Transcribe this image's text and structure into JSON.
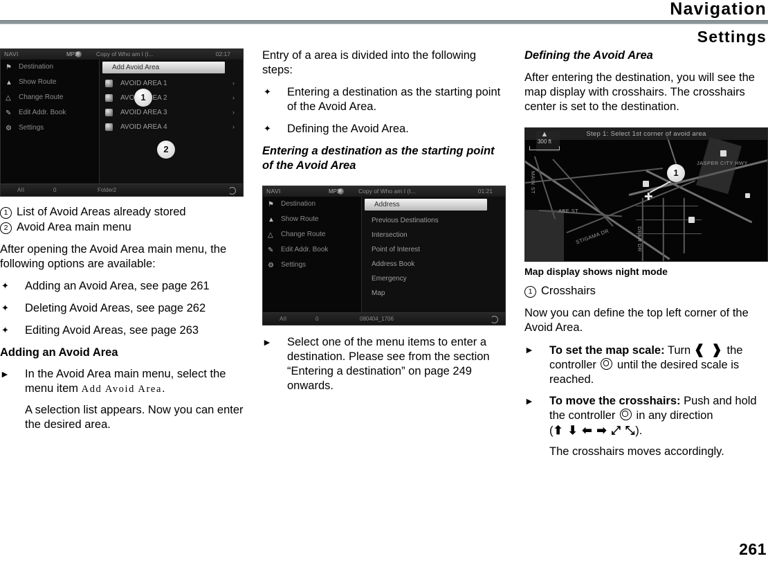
{
  "header": {
    "title": "Navigation",
    "subtitle": "Settings"
  },
  "page_number": "261",
  "column_1": {
    "screenshot": {
      "topbar": {
        "source": "NAVI",
        "disc_label": "MP3",
        "track": "Copy of Who am I (I...",
        "clock": "02:17"
      },
      "left_menu": [
        {
          "icon": "flag-icon",
          "label": "Destination"
        },
        {
          "icon": "route-icon",
          "label": "Show Route"
        },
        {
          "icon": "change-route-icon",
          "label": "Change Route"
        },
        {
          "icon": "pencil-icon",
          "label": "Edit Addr. Book"
        },
        {
          "icon": "gear-icon",
          "label": "Settings"
        }
      ],
      "highlighted_item": "Add Avoid Area",
      "avoid_areas": [
        "AVOID AREA 1",
        "AVOID AREA 2",
        "AVOID AREA 3",
        "AVOID AREA 4"
      ],
      "bottombar": {
        "left": "All",
        "mid": "0",
        "label": "Folder2"
      },
      "callouts": [
        "1",
        "2"
      ]
    },
    "legend": [
      {
        "num": "1",
        "text": "List of Avoid Areas already stored"
      },
      {
        "num": "2",
        "text": "Avoid Area main menu"
      }
    ],
    "intro": "After opening the Avoid Area main menu, the following options are available:",
    "bullets": [
      "Adding an Avoid Area, see page 261",
      "Deleting Avoid Areas, see page 262",
      "Editing Avoid Areas, see page 263"
    ],
    "heading": "Adding an Avoid Area",
    "action": {
      "text_before": "In the Avoid Area main menu, select the menu item ",
      "menu_ref": "Add Avoid Area",
      "text_after": ".",
      "follow": "A selection list appears. Now you can enter the desired area."
    }
  },
  "column_2": {
    "intro": "Entry of a area is divided into the following steps:",
    "bullets": [
      "Entering a destination as the starting point of the Avoid Area.",
      "Defining the Avoid Area."
    ],
    "heading": "Entering a destination as the starting point of the Avoid Area",
    "screenshot": {
      "topbar": {
        "source": "NAVI",
        "disc_label": "MP3",
        "track": "Copy of Who am I (I...",
        "clock": "01:21"
      },
      "left_menu": [
        {
          "icon": "flag-icon",
          "label": "Destination"
        },
        {
          "icon": "route-icon",
          "label": "Show Route"
        },
        {
          "icon": "change-route-icon",
          "label": "Change Route"
        },
        {
          "icon": "pencil-icon",
          "label": "Edit Addr. Book"
        },
        {
          "icon": "gear-icon",
          "label": "Settings"
        }
      ],
      "highlighted_item": "Address",
      "menu_items": [
        "Previous Destinations",
        "Intersection",
        "Point of Interest",
        "Address Book",
        "Emergency",
        "Map"
      ],
      "bottombar": {
        "left": "All",
        "mid": "0",
        "label": "080404_1706"
      }
    },
    "action": "Select one of the menu items to enter a destination. Please see from the section “Entering a destination” on page 249 onwards."
  },
  "column_3": {
    "heading": "Defining the Avoid Area",
    "intro": "After entering the destination, you will see the map display with crosshairs. The crosshairs center is set to the destination.",
    "map": {
      "banner": "Step 1: Select 1st corner of avoid area",
      "scale": "300 ft",
      "north_icon": "north-arrow-icon",
      "labels": [
        "JASPER CITY HWY",
        "ABE ST",
        "STIGAMA DR",
        "MAIN ST",
        "DEER DR"
      ],
      "callout": "1"
    },
    "caption": "Map display shows night mode",
    "legend": [
      {
        "num": "1",
        "text": "Crosshairs"
      }
    ],
    "para": "Now you can define the top left corner of the Avoid Area.",
    "actions": [
      {
        "bold": "To set the map scale:",
        "text_a": " Turn ",
        "glyph_rotate": "rotate-knob-icon",
        "text_b": " the controller ",
        "glyph_knob": "controller-knob-icon",
        "text_c": " until the desired scale is reached."
      },
      {
        "bold": "To move the crosshairs:",
        "text_a": " Push and hold the controller ",
        "glyph_knob": "controller-knob-icon",
        "text_b": " in any direction (",
        "glyph_dirs": "direction-arrows-icon",
        "text_c": ").",
        "follow": "The crosshairs moves accordingly."
      }
    ]
  }
}
